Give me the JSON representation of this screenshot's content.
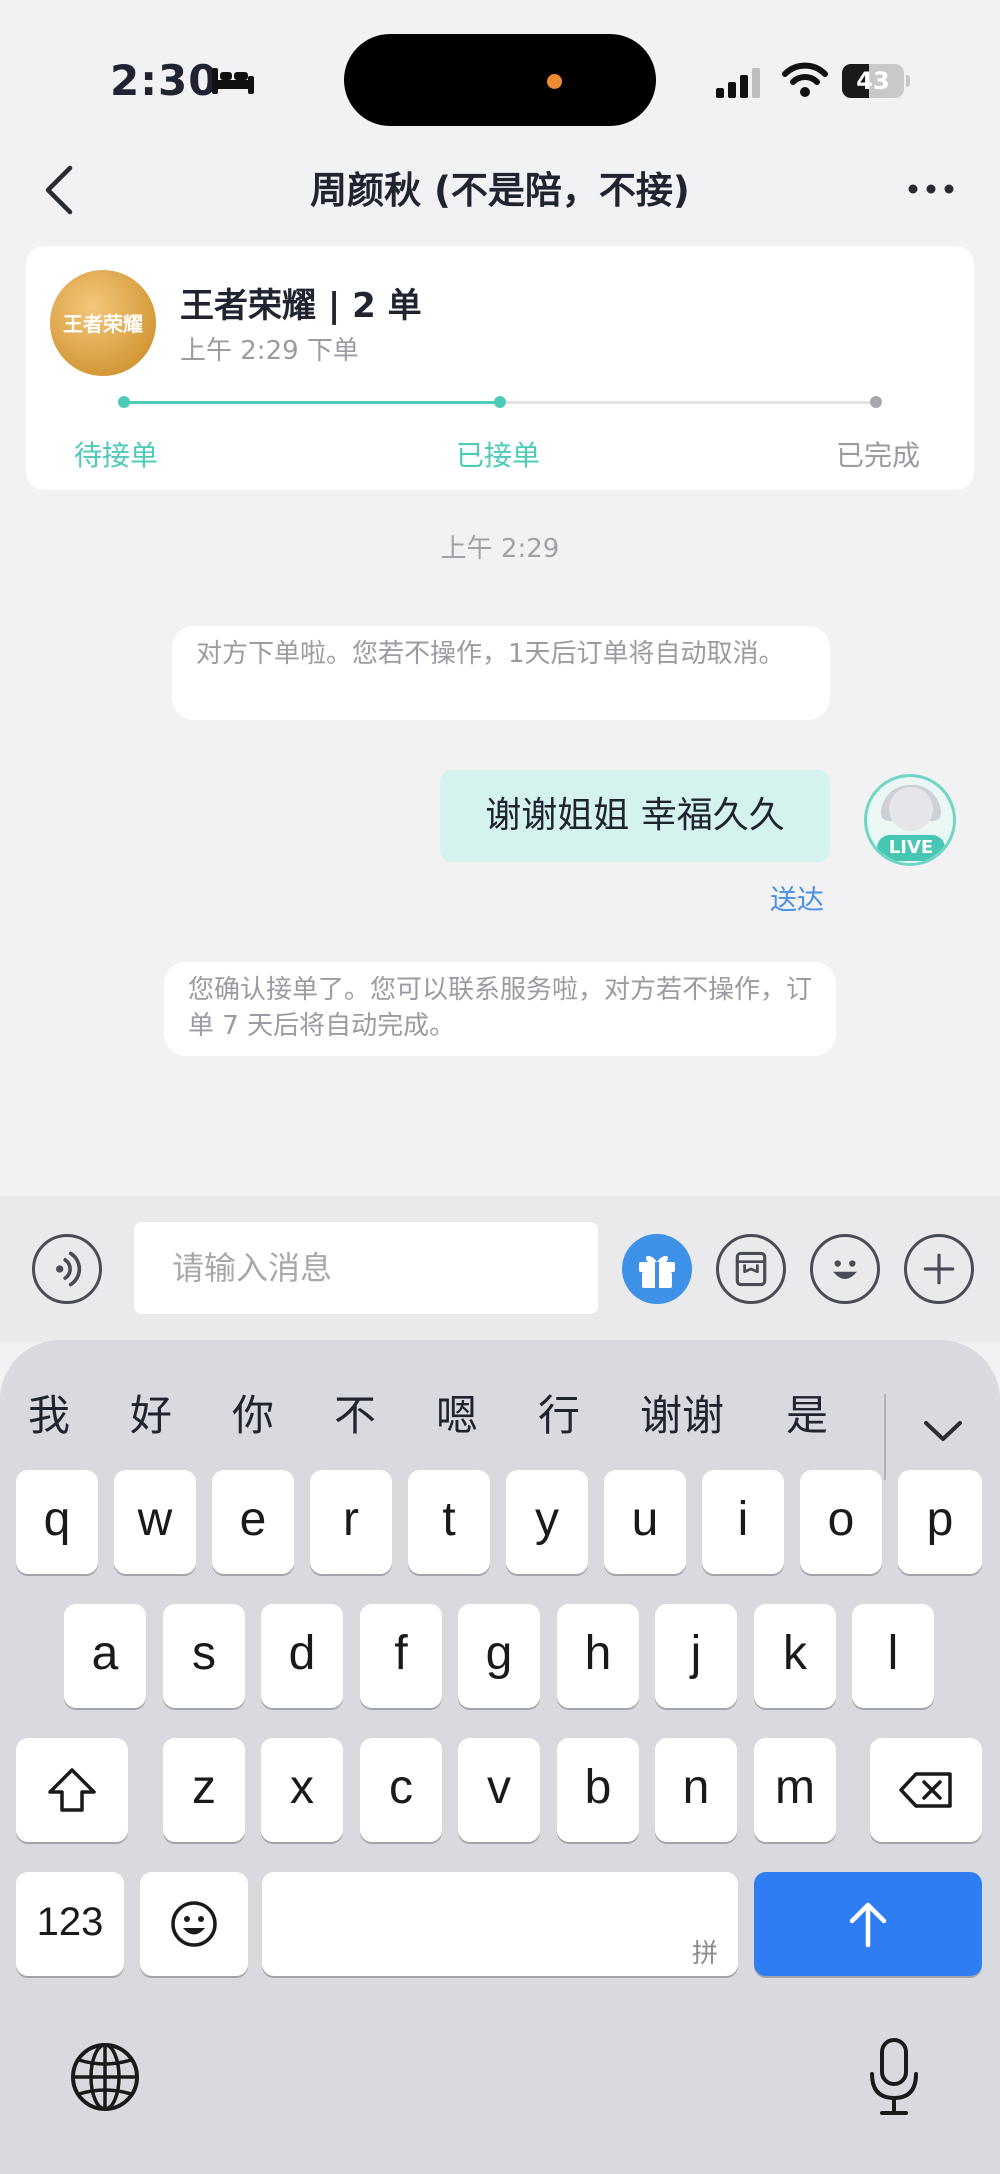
{
  "status": {
    "time": "2:30",
    "battery_level": "43",
    "battery_fraction": 0.43,
    "sleep_icon": "bed-icon",
    "signal_icon": "cellular-signal-icon",
    "wifi_icon": "wifi-icon"
  },
  "nav": {
    "title": "周颜秋 (不是陪，不接)",
    "back_icon": "chevron-left-icon",
    "more_icon": "more-dots-icon"
  },
  "order": {
    "game_title": "王者荣耀 | 2 单",
    "time": "上午 2:29 下单",
    "logo_text": "王者荣耀",
    "steps": [
      "待接单",
      "已接单",
      "已完成"
    ],
    "current_step_index": 1,
    "accent_color": "#4ecbb8"
  },
  "chat": {
    "timestamp": "上午 2:29",
    "system_message_1": "对方下单啦。您若不操作，1天后订单将自动取消。",
    "my_message": "谢谢姐姐 幸福久久",
    "avatar_badge": "LIVE",
    "delivered": "送达",
    "system_message_2": "您确认接单了。您可以联系服务啦，对方若不操作，订单 7 天后将自动完成。"
  },
  "input_bar": {
    "placeholder": "请输入消息",
    "icons": [
      "voice-icon",
      "gift-icon",
      "album-icon",
      "emoji-icon",
      "plus-icon"
    ]
  },
  "keyboard": {
    "suggestions": [
      "我",
      "好",
      "你",
      "不",
      "嗯",
      "行",
      "谢谢",
      "是"
    ],
    "row1": [
      "q",
      "w",
      "e",
      "r",
      "t",
      "y",
      "u",
      "i",
      "o",
      "p"
    ],
    "row2": [
      "a",
      "s",
      "d",
      "f",
      "g",
      "h",
      "j",
      "k",
      "l"
    ],
    "row3": [
      "z",
      "x",
      "c",
      "v",
      "b",
      "n",
      "m"
    ],
    "numbers_key": "123",
    "space_hint": "拼",
    "send_color": "#2f7df2"
  }
}
